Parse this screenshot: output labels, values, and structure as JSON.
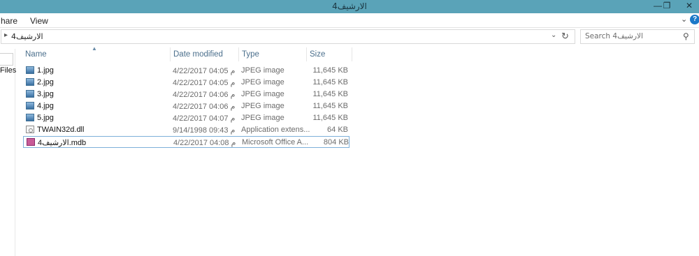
{
  "window": {
    "title": "الارشيف4",
    "minimize_glyph": "—",
    "restore_glyph": "❐",
    "close_glyph": "✕"
  },
  "ribbon": {
    "tabs": [
      "hare",
      "View"
    ],
    "expand_glyph": "⌄",
    "help_glyph": "?"
  },
  "address": {
    "path": "الارشيف4",
    "chevron_glyph": "▸",
    "dropdown_glyph": "⌄",
    "refresh_glyph": "↻"
  },
  "search": {
    "placeholder": "Search الارشيف4",
    "icon_glyph": "⚲"
  },
  "nav": {
    "label": "Files"
  },
  "columns": {
    "name": "Name",
    "date": "Date modified",
    "type": "Type",
    "size": "Size",
    "sort_glyph": "▲"
  },
  "files": [
    {
      "name": "1.jpg",
      "date": "4/22/2017 04:05 م",
      "type": "JPEG image",
      "size": "11,645 KB",
      "icon": "jpeg-image-icon"
    },
    {
      "name": "2.jpg",
      "date": "4/22/2017 04:05 م",
      "type": "JPEG image",
      "size": "11,645 KB",
      "icon": "jpeg-image-icon"
    },
    {
      "name": "3.jpg",
      "date": "4/22/2017 04:06 م",
      "type": "JPEG image",
      "size": "11,645 KB",
      "icon": "jpeg-image-icon"
    },
    {
      "name": "4.jpg",
      "date": "4/22/2017 04:06 م",
      "type": "JPEG image",
      "size": "11,645 KB",
      "icon": "jpeg-image-icon"
    },
    {
      "name": "5.jpg",
      "date": "4/22/2017 04:07 م",
      "type": "JPEG image",
      "size": "11,645 KB",
      "icon": "jpeg-image-icon"
    },
    {
      "name": "TWAIN32d.dll",
      "date": "9/14/1998 09:43 م",
      "type": "Application extens...",
      "size": "64 KB",
      "icon": "dll-file-icon"
    },
    {
      "name": "الارشيف4.mdb",
      "date": "4/22/2017 04:08 م",
      "type": "Microsoft Office A...",
      "size": "804 KB",
      "icon": "access-database-icon",
      "selected": true
    }
  ],
  "colors": {
    "titlebar": "#5aa3b8",
    "header_text": "#4b6f8c",
    "selection_border": "#7db0d9"
  }
}
